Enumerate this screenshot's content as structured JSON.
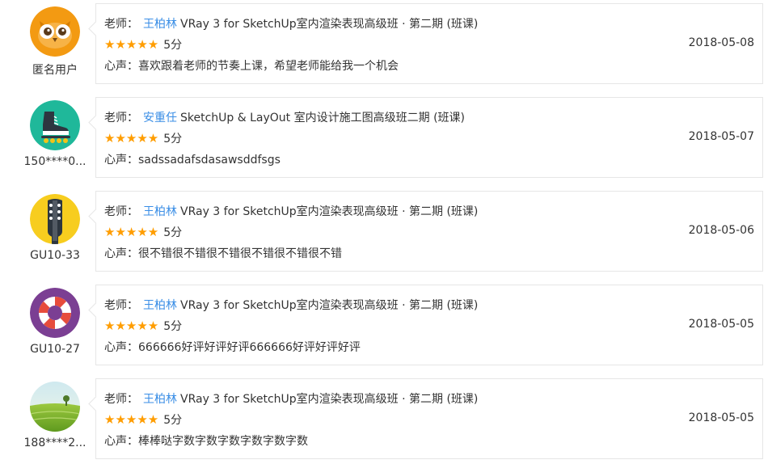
{
  "reviews": [
    {
      "user": "匿名用户",
      "avatar": "owl-avatar-icon",
      "teacher_prefix": "老师：",
      "teacher": "王柏林",
      "course": "VRay 3 for SketchUp室内渲染表现高级班 · 第二期 (班课)",
      "stars": "★★★★★",
      "rating_value": 5,
      "score": "5分",
      "date": "2018-05-08",
      "comment_prefix": "心声：",
      "comment": "喜欢跟着老师的节奏上课，希望老师能给我一个机会"
    },
    {
      "user": "150****0...",
      "avatar": "skate-shoe-avatar-icon",
      "teacher_prefix": "老师：",
      "teacher": "安重任",
      "course": "SketchUp & LayOut 室内设计施工图高级班二期 (班课)",
      "stars": "★★★★★",
      "rating_value": 5,
      "score": "5分",
      "date": "2018-05-07",
      "comment_prefix": "心声：",
      "comment": "sadssadafsdasawsddfsgs"
    },
    {
      "user": "GU10-33",
      "avatar": "guitar-avatar-icon",
      "teacher_prefix": "老师：",
      "teacher": "王柏林",
      "course": "VRay 3 for SketchUp室内渲染表现高级班 · 第二期 (班课)",
      "stars": "★★★★★",
      "rating_value": 5,
      "score": "5分",
      "date": "2018-05-06",
      "comment_prefix": "心声：",
      "comment": "很不错很不错很不错很不错很不错很不错"
    },
    {
      "user": "GU10-27",
      "avatar": "lifebuoy-avatar-icon",
      "teacher_prefix": "老师：",
      "teacher": "王柏林",
      "course": "VRay 3 for SketchUp室内渲染表现高级班 · 第二期 (班课)",
      "stars": "★★★★★",
      "rating_value": 5,
      "score": "5分",
      "date": "2018-05-05",
      "comment_prefix": "心声：",
      "comment": "666666好评好评好评666666好评好评好评"
    },
    {
      "user": "188****2...",
      "avatar": "landscape-avatar-icon",
      "teacher_prefix": "老师：",
      "teacher": "王柏林",
      "course": "VRay 3 for SketchUp室内渲染表现高级班 · 第二期 (班课)",
      "stars": "★★★★★",
      "rating_value": 5,
      "score": "5分",
      "date": "2018-05-05",
      "comment_prefix": "心声：",
      "comment": "棒棒哒字数字数字数字数字数字数"
    }
  ],
  "colors": {
    "link": "#3a8ee6",
    "star": "#ff9d00",
    "border": "#e6e6e6"
  }
}
